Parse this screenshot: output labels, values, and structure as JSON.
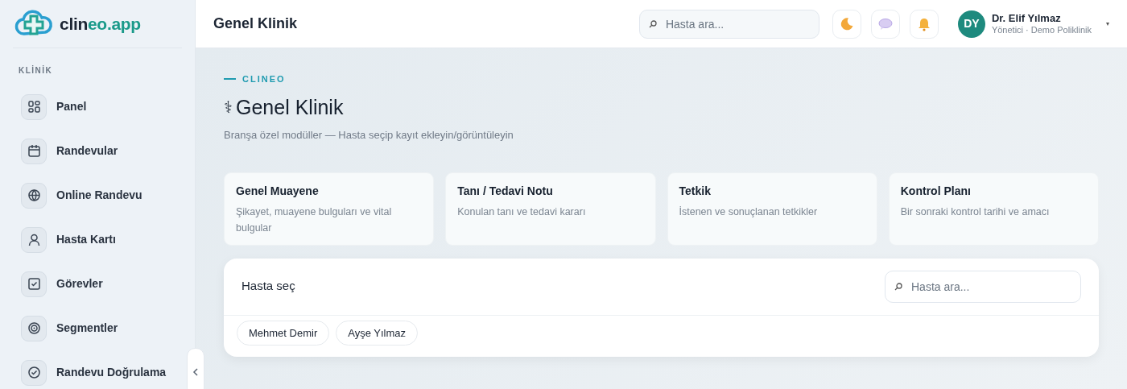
{
  "brand": {
    "name_dark": "clin",
    "name_accent": "eo.app"
  },
  "sidebar": {
    "section": "KLİNİK",
    "items": [
      {
        "label": "Panel"
      },
      {
        "label": "Randevular"
      },
      {
        "label": "Online Randevu"
      },
      {
        "label": "Hasta Kartı"
      },
      {
        "label": "Görevler"
      },
      {
        "label": "Segmentler"
      },
      {
        "label": "Randevu Doğrulama"
      }
    ]
  },
  "topbar": {
    "title": "Genel Klinik",
    "search": {
      "placeholder": "Hasta ara..."
    },
    "user": {
      "initials": "DY",
      "name": "Dr. Elif Yılmaz",
      "role": "Yönetici · Demo Poliklinik",
      "caret": "▾"
    }
  },
  "header": {
    "eyebrow": "CLINEO",
    "symbol": "⚕",
    "title": "Genel Klinik",
    "subtitle": "Branşa özel modüller — Hasta seçip kayıt ekleyin/görüntüleyin"
  },
  "modules": [
    {
      "title": "Genel Muayene",
      "description": "Şikayet, muayene bulguları ve vital bulgular"
    },
    {
      "title": "Tanı / Tedavi Notu",
      "description": "Konulan tanı ve tedavi kararı"
    },
    {
      "title": "Tetkik",
      "description": "İstenen ve sonuçlanan tetkikler"
    },
    {
      "title": "Kontrol Planı",
      "description": "Bir sonraki kontrol tarihi ve amacı"
    }
  ],
  "patient_picker": {
    "title": "Hasta seç",
    "search": {
      "placeholder": "Hasta ara..."
    },
    "patients": [
      {
        "name": "Mehmet Demir"
      },
      {
        "name": "Ayşe Yılmaz"
      }
    ]
  }
}
